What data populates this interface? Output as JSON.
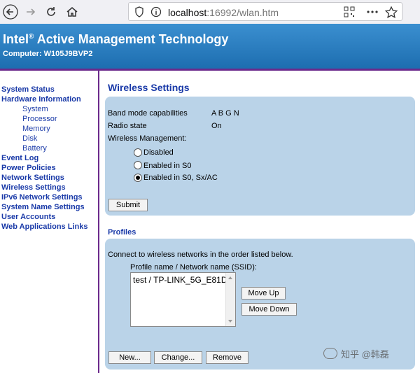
{
  "browser": {
    "url_host": "localhost",
    "url_rest": ":16992/wlan.htm"
  },
  "header": {
    "title_pre": "Intel",
    "title_reg": "®",
    "title_post": " Active Management Technology",
    "computer": "Computer: W105J9BVP2"
  },
  "sidebar": {
    "items": [
      {
        "label": "System Status"
      },
      {
        "label": "Hardware Information"
      },
      {
        "label": "System"
      },
      {
        "label": "Processor"
      },
      {
        "label": "Memory"
      },
      {
        "label": "Disk"
      },
      {
        "label": "Battery"
      },
      {
        "label": "Event Log"
      },
      {
        "label": "Power Policies"
      },
      {
        "label": "Network Settings"
      },
      {
        "label": "Wireless Settings"
      },
      {
        "label": "IPv6 Network Settings"
      },
      {
        "label": "System Name Settings"
      },
      {
        "label": "User Accounts"
      },
      {
        "label": "Web Applications Links"
      }
    ]
  },
  "wireless": {
    "title": "Wireless Settings",
    "band_label": "Band mode capabilities",
    "band_value": "A B G N",
    "radio_label": "Radio state",
    "radio_value": "On",
    "mgmt_label": "Wireless Management:",
    "options": [
      "Disabled",
      "Enabled in S0",
      "Enabled in S0, Sx/AC"
    ],
    "selected_index": 2,
    "submit_label": "Submit"
  },
  "profiles": {
    "title": "Profiles",
    "intro": "Connect to wireless networks in the order listed below.",
    "column_label": "Profile name / Network name (SSID):",
    "items": [
      "test / TP-LINK_5G_E81D"
    ],
    "move_up_label": "Move Up",
    "move_down_label": "Move Down",
    "new_label": "New...",
    "change_label": "Change...",
    "remove_label": "Remove"
  },
  "watermark": "知乎 @韩磊"
}
